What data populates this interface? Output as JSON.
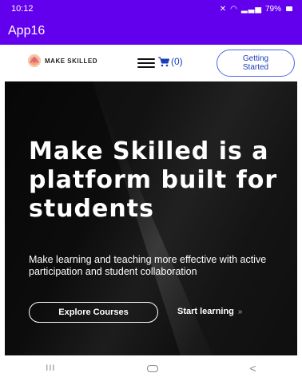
{
  "status_bar": {
    "time": "10:12",
    "battery": "79%",
    "icons": [
      "mute-icon",
      "wifi-icon",
      "signal-icon",
      "battery-icon"
    ]
  },
  "app_bar": {
    "title": "App16"
  },
  "header": {
    "brand_name": "MAKE SKILLED",
    "cart_count": "(0)",
    "getting_started_label": "Getting Started",
    "colors": {
      "accent": "#1a3fb5",
      "border": "#4a6be0"
    }
  },
  "hero": {
    "title": "Make Skilled is a platform built for students",
    "subtitle": "Make learning and teaching more effective with active participation and student collaboration",
    "explore_button_label": "Explore Courses",
    "start_learning_label": "Start learning",
    "start_learning_arrow": "»"
  },
  "nav_bar": {
    "recents": "III",
    "back": "<"
  },
  "colors": {
    "app_bar": "#6200ee",
    "hero_background": "#0a0a0a",
    "text_on_dark": "#ffffff"
  }
}
